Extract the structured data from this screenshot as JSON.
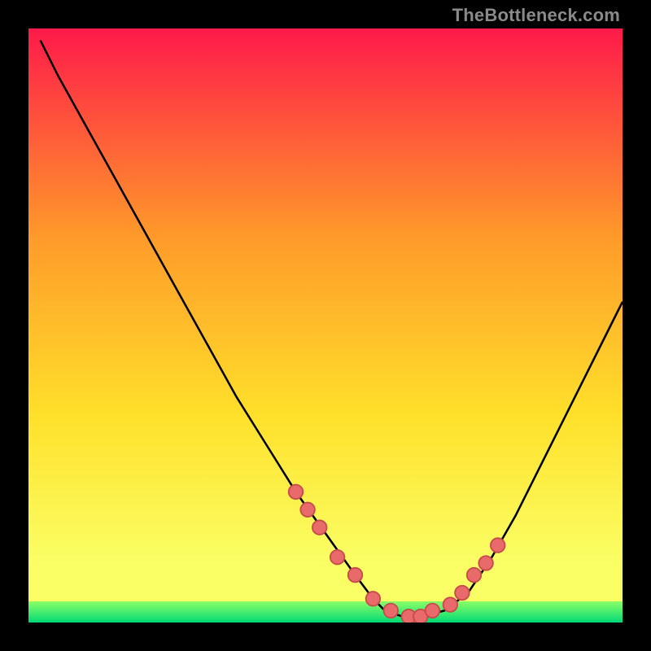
{
  "watermark": "TheBottleneck.com",
  "colors": {
    "black": "#000000",
    "grad_top": "#ff1a4a",
    "grad_mid1": "#ff9a2a",
    "grad_mid2": "#ffe02a",
    "grad_low": "#faff66",
    "green_top": "#8bff66",
    "green_bot": "#00d976",
    "curve": "#000000",
    "marker_fill": "#e86a6a",
    "marker_stroke": "#c74b4b"
  },
  "chart_data": {
    "type": "line",
    "title": "",
    "xlabel": "",
    "ylabel": "",
    "xlim": [
      0,
      100
    ],
    "ylim": [
      0,
      100
    ],
    "series": [
      {
        "name": "bottleneck-curve",
        "x": [
          2,
          5,
          10,
          15,
          20,
          25,
          30,
          35,
          40,
          45,
          50,
          55,
          58,
          60,
          63,
          66,
          70,
          74,
          78,
          82,
          86,
          90,
          94,
          98,
          100
        ],
        "y": [
          98,
          92,
          83,
          74,
          65,
          56,
          47,
          38,
          30,
          22,
          15,
          8,
          4,
          2,
          1,
          1,
          2,
          5,
          11,
          18,
          26,
          34,
          42,
          50,
          54
        ]
      }
    ],
    "markers": {
      "name": "highlight-points",
      "x": [
        45,
        47,
        49,
        52,
        55,
        58,
        61,
        64,
        66,
        68,
        71,
        73,
        75,
        77,
        79
      ],
      "y": [
        22,
        19,
        16,
        11,
        8,
        4,
        2,
        1,
        1,
        2,
        3,
        5,
        8,
        10,
        13
      ]
    }
  }
}
